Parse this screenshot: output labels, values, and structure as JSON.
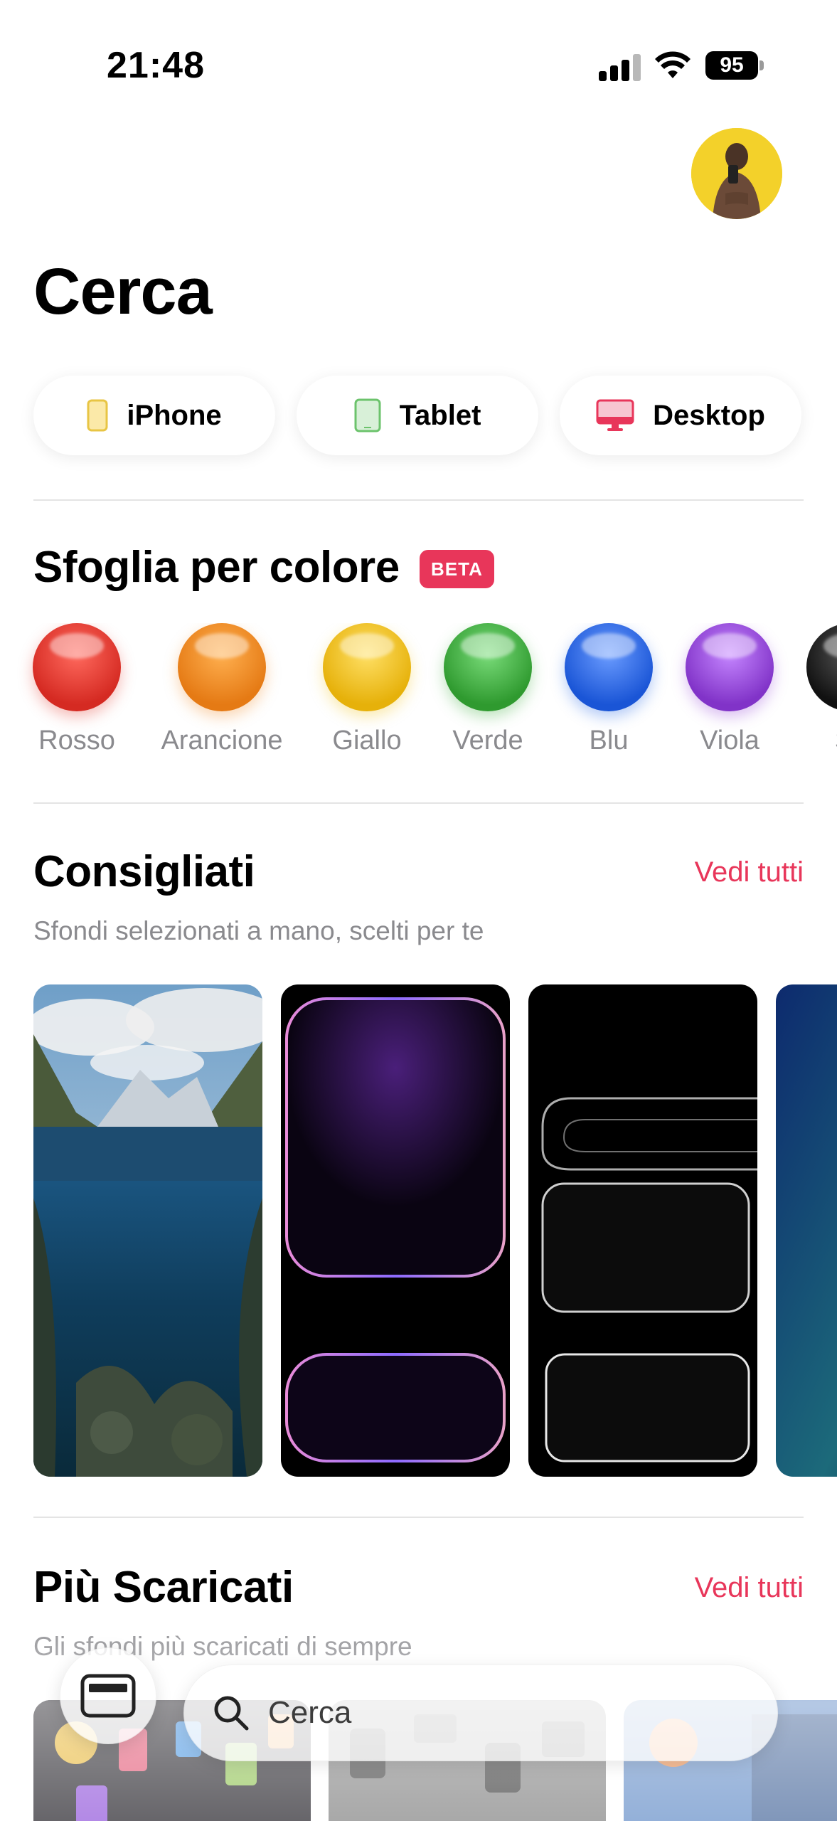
{
  "status": {
    "time": "21:48",
    "battery": "95"
  },
  "header": {
    "title": "Cerca"
  },
  "devices": [
    {
      "label": "iPhone",
      "icon": "iphone-icon",
      "color": "#e8c544"
    },
    {
      "label": "Tablet",
      "icon": "tablet-icon",
      "color": "#6cc36c"
    },
    {
      "label": "Desktop",
      "icon": "desktop-icon",
      "color": "#e8365a"
    }
  ],
  "colors_section": {
    "title": "Sfoglia per colore",
    "badge": "BETA",
    "items": [
      {
        "label": "Rosso",
        "color": "#e23b32"
      },
      {
        "label": "Arancione",
        "color": "#f08a24"
      },
      {
        "label": "Giallo",
        "color": "#f1c21b"
      },
      {
        "label": "Verde",
        "color": "#3fae3f"
      },
      {
        "label": "Blu",
        "color": "#2566e6"
      },
      {
        "label": "Viola",
        "color": "#9445d8"
      },
      {
        "label": "Sc",
        "color": "#1a1a1a"
      }
    ]
  },
  "featured": {
    "title": "Consigliati",
    "see_all": "Vedi tutti",
    "subtitle": "Sfondi selezionati a mano, scelti per te"
  },
  "most_downloaded": {
    "title": "Più Scaricati",
    "see_all": "Vedi tutti",
    "subtitle": "Gli sfondi più scaricati di sempre"
  },
  "search": {
    "placeholder": "Cerca"
  },
  "accent_color": "#e8365a"
}
